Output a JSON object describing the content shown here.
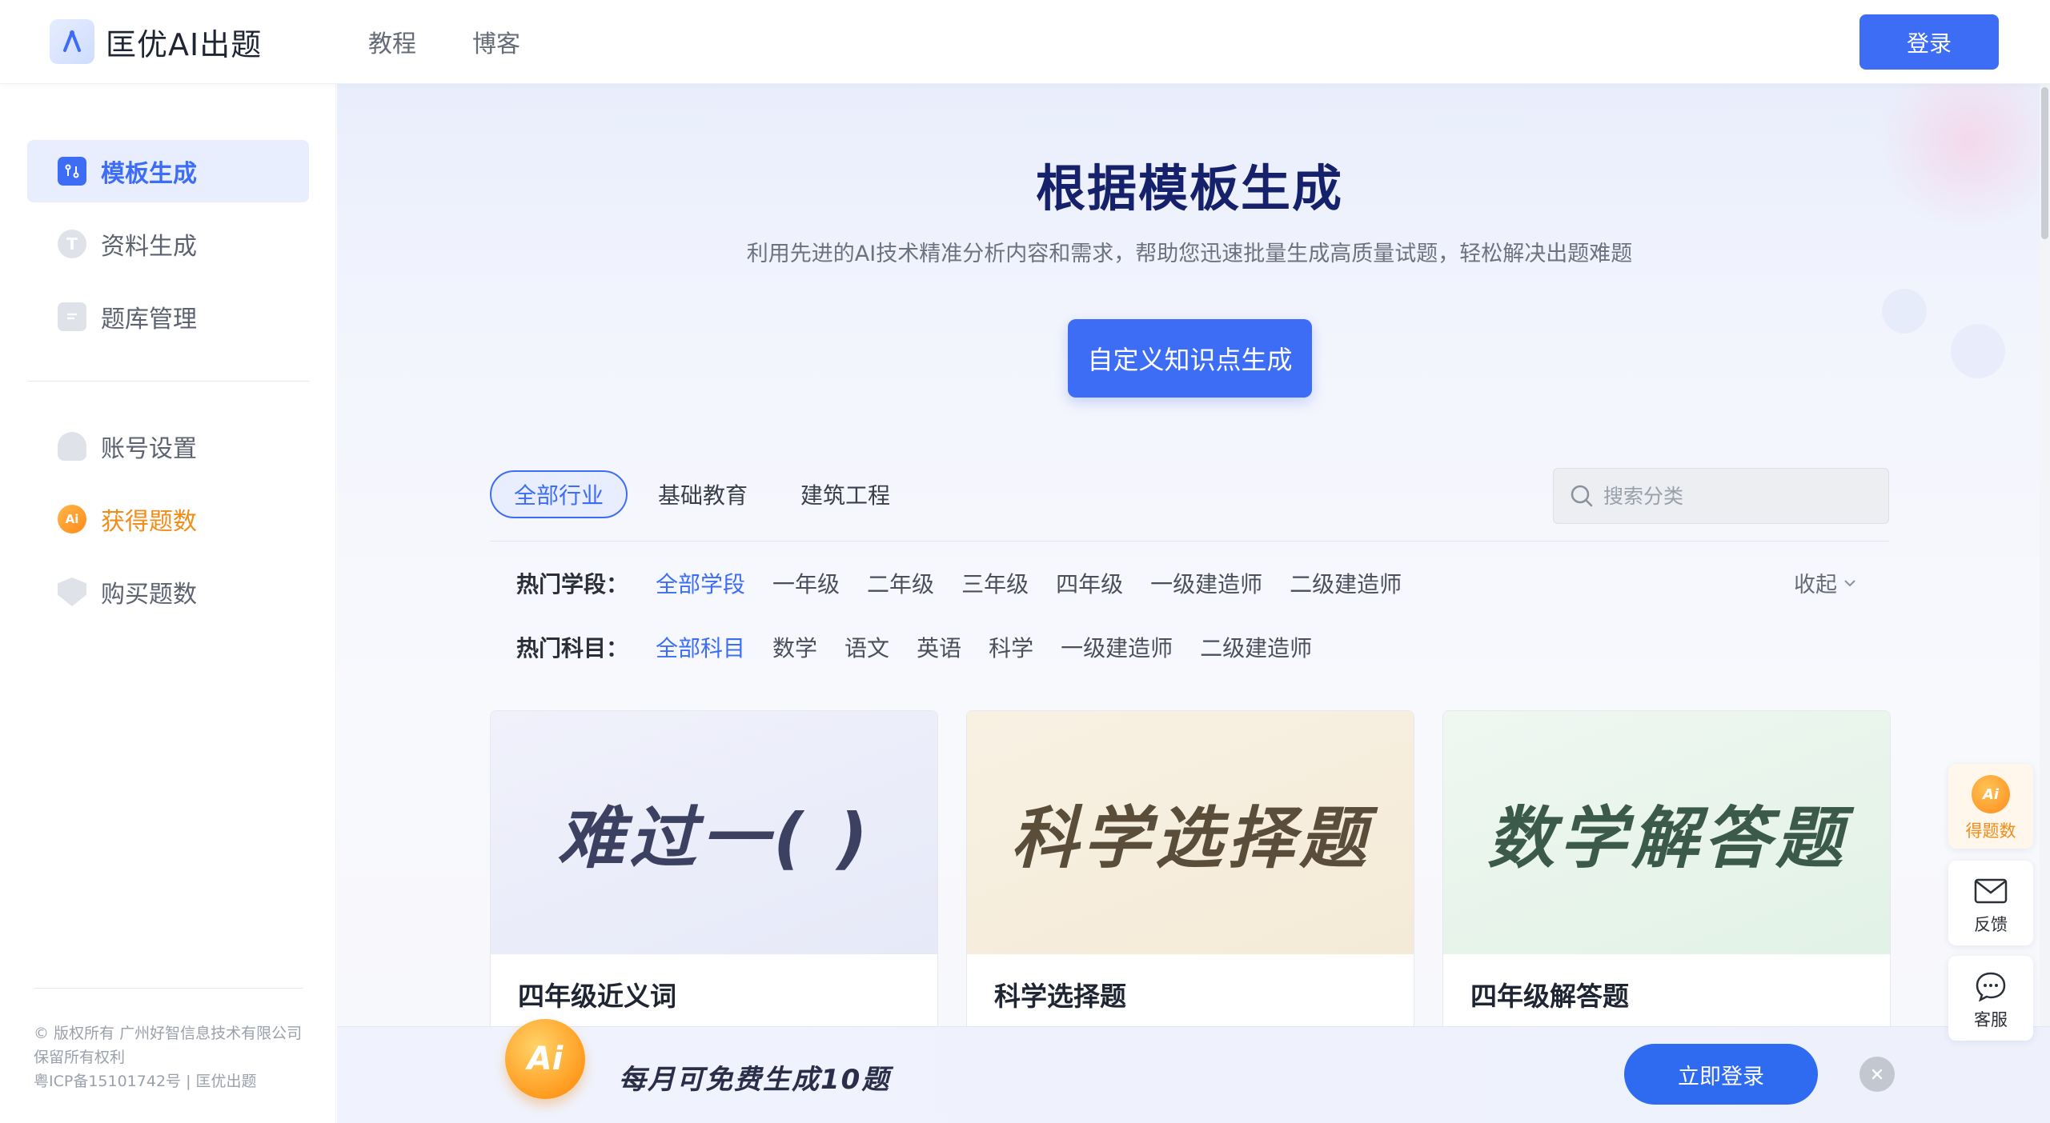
{
  "header": {
    "app_name": "匡优AI出题",
    "nav": [
      "教程",
      "博客"
    ],
    "login_label": "登录"
  },
  "sidebar": {
    "items": [
      {
        "label": "模板生成",
        "icon": "template-icon",
        "active": true
      },
      {
        "label": "资料生成",
        "icon": "material-icon"
      },
      {
        "label": "题库管理",
        "icon": "question-bank-icon"
      },
      {
        "label": "账号设置",
        "icon": "account-icon"
      },
      {
        "label": "获得题数",
        "icon": "ai-coin-icon",
        "highlight": true
      },
      {
        "label": "购买题数",
        "icon": "diamond-icon"
      }
    ],
    "copyright": {
      "line1": "© 版权所有 广州好智信息技术有限公司",
      "line2": "保留所有权利",
      "line3": "粤ICP备15101742号 | 匡优出题"
    }
  },
  "hero": {
    "title": "根据模板生成",
    "subtitle": "利用先进的AI技术精准分析内容和需求，帮助您迅速批量生成高质量试题，轻松解决出题难题",
    "button_label": "自定义知识点生成"
  },
  "industry_tabs": {
    "items": [
      "全部行业",
      "基础教育",
      "建筑工程"
    ],
    "active_index": 0
  },
  "search": {
    "placeholder": "搜索分类",
    "value": ""
  },
  "filters": {
    "stage": {
      "label": "热门学段：",
      "options": [
        "全部学段",
        "一年级",
        "二年级",
        "三年级",
        "四年级",
        "一级建造师",
        "二级建造师"
      ],
      "selected": 0
    },
    "subject": {
      "label": "热门科目：",
      "options": [
        "全部科目",
        "数学",
        "语文",
        "英语",
        "科学",
        "一级建造师",
        "二级建造师"
      ],
      "selected": 0
    },
    "collapse_label": "收起"
  },
  "cards": [
    {
      "banner_text": "难过一(    )",
      "title": "四年级近义词"
    },
    {
      "banner_text": "科学选择题",
      "title": "科学选择题"
    },
    {
      "banner_text": "数学解答题",
      "title": "四年级解答题"
    }
  ],
  "promo": {
    "coin_text": "Ai",
    "text": "每月可免费生成10题",
    "button_label": "立即登录"
  },
  "float_panel": {
    "ai": {
      "coin_text": "Ai",
      "label": "得题数"
    },
    "feedback": {
      "label": "反馈"
    },
    "service": {
      "label": "客服"
    }
  },
  "colors": {
    "primary": "#3d6df5",
    "hero_title": "#15216b",
    "gold": "#f28c18"
  }
}
